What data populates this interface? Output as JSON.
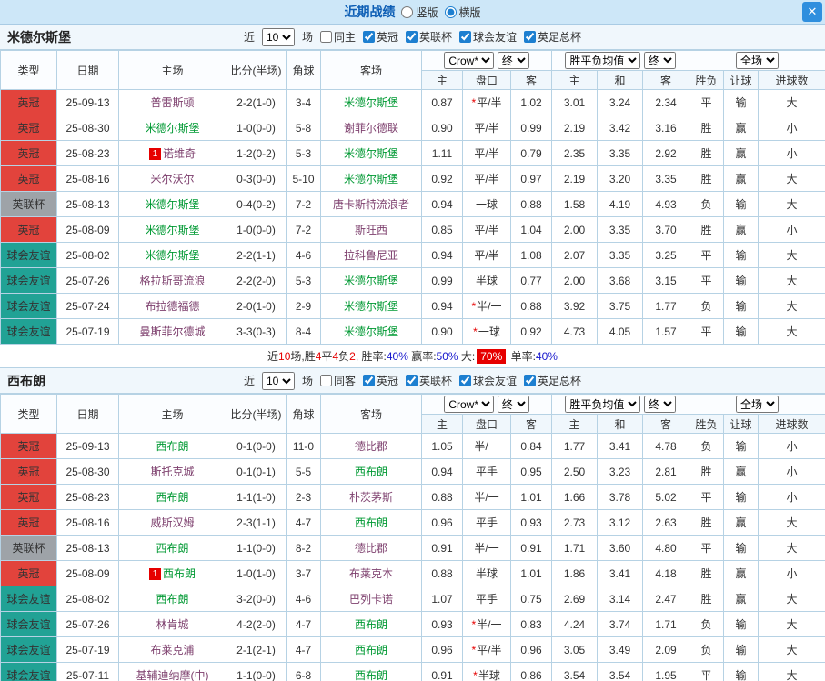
{
  "topbar": {
    "title": "近期战绩",
    "radio_vertical": "竖版",
    "radio_horizontal": "横版"
  },
  "filters": {
    "near_label": "近",
    "count": "10",
    "games_label": "场",
    "leagues": [
      "英冠",
      "英联杯",
      "球会友谊",
      "英足总杯"
    ]
  },
  "header": {
    "col_type": "类型",
    "col_date": "日期",
    "col_home": "主场",
    "col_score": "比分(半场)",
    "col_corner": "角球",
    "col_away": "客场",
    "select_company": "Crow*",
    "select_final": "终",
    "select_avg": "胜平负均值",
    "select_period": "全场",
    "sub_home": "主",
    "sub_handicap": "盘口",
    "sub_away": "客",
    "sub_draw": "和",
    "sub_result": "胜负",
    "sub_let": "让球",
    "sub_goals": "进球数"
  },
  "star_mark": "*",
  "rank_mark": "1",
  "colors": {
    "accent_blue": "#1d7fd0",
    "badge_red": "#e2433c",
    "badge_gray": "#9ea3a8",
    "badge_teal": "#21a295",
    "focus_green": "#009933",
    "score_red": "#e60000"
  },
  "team1": {
    "name": "米德尔斯堡",
    "same_label": "同主",
    "rows": [
      {
        "type": "英冠",
        "date": "25-09-13",
        "home": "普雷斯顿",
        "home_focus": false,
        "home_mark": false,
        "score": "2-2(1-0)",
        "corner": "3-4",
        "away": "米德尔斯堡",
        "away_focus": true,
        "away_mark": false,
        "odds_home": "0.87",
        "handicap_star": true,
        "handicap": "平/半",
        "odds_away": "1.02",
        "avg_home": "3.01",
        "avg_draw": "3.24",
        "avg_away": "2.34",
        "result": "平",
        "let_result": "输",
        "goals": "大"
      },
      {
        "type": "英冠",
        "date": "25-08-30",
        "home": "米德尔斯堡",
        "home_focus": true,
        "home_mark": false,
        "score": "1-0(0-0)",
        "corner": "5-8",
        "away": "谢菲尔德联",
        "away_focus": false,
        "away_mark": false,
        "odds_home": "0.90",
        "handicap_star": false,
        "handicap": "平/半",
        "odds_away": "0.99",
        "avg_home": "2.19",
        "avg_draw": "3.42",
        "avg_away": "3.16",
        "result": "胜",
        "let_result": "赢",
        "goals": "小"
      },
      {
        "type": "英冠",
        "date": "25-08-23",
        "home": "诺维奇",
        "home_focus": false,
        "home_mark": true,
        "score": "1-2(0-2)",
        "corner": "5-3",
        "away": "米德尔斯堡",
        "away_focus": true,
        "away_mark": false,
        "odds_home": "1.11",
        "handicap_star": false,
        "handicap": "平/半",
        "odds_away": "0.79",
        "avg_home": "2.35",
        "avg_draw": "3.35",
        "avg_away": "2.92",
        "result": "胜",
        "let_result": "赢",
        "goals": "小"
      },
      {
        "type": "英冠",
        "date": "25-08-16",
        "home": "米尔沃尔",
        "home_focus": false,
        "home_mark": false,
        "score": "0-3(0-0)",
        "corner": "5-10",
        "away": "米德尔斯堡",
        "away_focus": true,
        "away_mark": false,
        "odds_home": "0.92",
        "handicap_star": false,
        "handicap": "平/半",
        "odds_away": "0.97",
        "avg_home": "2.19",
        "avg_draw": "3.20",
        "avg_away": "3.35",
        "result": "胜",
        "let_result": "赢",
        "goals": "大"
      },
      {
        "type": "英联杯",
        "date": "25-08-13",
        "home": "米德尔斯堡",
        "home_focus": true,
        "home_mark": false,
        "score": "0-4(0-2)",
        "corner": "7-2",
        "away": "唐卡斯特流浪者",
        "away_focus": false,
        "away_mark": false,
        "odds_home": "0.94",
        "handicap_star": false,
        "handicap": "一球",
        "odds_away": "0.88",
        "avg_home": "1.58",
        "avg_draw": "4.19",
        "avg_away": "4.93",
        "result": "负",
        "let_result": "输",
        "goals": "大"
      },
      {
        "type": "英冠",
        "date": "25-08-09",
        "home": "米德尔斯堡",
        "home_focus": true,
        "home_mark": false,
        "score": "1-0(0-0)",
        "corner": "7-2",
        "away": "斯旺西",
        "away_focus": false,
        "away_mark": false,
        "odds_home": "0.85",
        "handicap_star": false,
        "handicap": "平/半",
        "odds_away": "1.04",
        "avg_home": "2.00",
        "avg_draw": "3.35",
        "avg_away": "3.70",
        "result": "胜",
        "let_result": "赢",
        "goals": "小"
      },
      {
        "type": "球会友谊",
        "date": "25-08-02",
        "home": "米德尔斯堡",
        "home_focus": true,
        "home_mark": false,
        "score": "2-2(1-1)",
        "corner": "4-6",
        "away": "拉科鲁尼亚",
        "away_focus": false,
        "away_mark": false,
        "odds_home": "0.94",
        "handicap_star": false,
        "handicap": "平/半",
        "odds_away": "1.08",
        "avg_home": "2.07",
        "avg_draw": "3.35",
        "avg_away": "3.25",
        "result": "平",
        "let_result": "输",
        "goals": "大"
      },
      {
        "type": "球会友谊",
        "date": "25-07-26",
        "home": "格拉斯哥流浪",
        "home_focus": false,
        "home_mark": false,
        "score": "2-2(2-0)",
        "corner": "5-3",
        "away": "米德尔斯堡",
        "away_focus": true,
        "away_mark": false,
        "odds_home": "0.99",
        "handicap_star": false,
        "handicap": "半球",
        "odds_away": "0.77",
        "avg_home": "2.00",
        "avg_draw": "3.68",
        "avg_away": "3.15",
        "result": "平",
        "let_result": "输",
        "goals": "大"
      },
      {
        "type": "球会友谊",
        "date": "25-07-24",
        "home": "布拉德福德",
        "home_focus": false,
        "home_mark": false,
        "score": "2-0(1-0)",
        "corner": "2-9",
        "away": "米德尔斯堡",
        "away_focus": true,
        "away_mark": false,
        "odds_home": "0.94",
        "handicap_star": true,
        "handicap": "半/一",
        "odds_away": "0.88",
        "avg_home": "3.92",
        "avg_draw": "3.75",
        "avg_away": "1.77",
        "result": "负",
        "let_result": "输",
        "goals": "大"
      },
      {
        "type": "球会友谊",
        "date": "25-07-19",
        "home": "曼斯菲尔德城",
        "home_focus": false,
        "home_mark": false,
        "score": "3-3(0-3)",
        "corner": "8-4",
        "away": "米德尔斯堡",
        "away_focus": true,
        "away_mark": false,
        "odds_home": "0.90",
        "handicap_star": true,
        "handicap": "一球",
        "odds_away": "0.92",
        "avg_home": "4.73",
        "avg_draw": "4.05",
        "avg_away": "1.57",
        "result": "平",
        "let_result": "输",
        "goals": "大"
      }
    ],
    "summary": [
      {
        "text": "近",
        "style": "plain"
      },
      {
        "text": "10",
        "style": "red"
      },
      {
        "text": "场,胜",
        "style": "plain"
      },
      {
        "text": "4",
        "style": "red"
      },
      {
        "text": "平",
        "style": "plain"
      },
      {
        "text": "4",
        "style": "red"
      },
      {
        "text": "负",
        "style": "plain"
      },
      {
        "text": "2",
        "style": "red"
      },
      {
        "text": ", 胜率:",
        "style": "plain"
      },
      {
        "text": "40%",
        "style": "blue"
      },
      {
        "text": " 赢率:",
        "style": "plain"
      },
      {
        "text": "50%",
        "style": "blue"
      },
      {
        "text": " 大:",
        "style": "plain"
      },
      {
        "text": "70%",
        "style": "hot"
      },
      {
        "text": " 单率:",
        "style": "plain"
      },
      {
        "text": "40%",
        "style": "blue"
      }
    ]
  },
  "team2": {
    "name": "西布朗",
    "same_label": "同客",
    "rows": [
      {
        "type": "英冠",
        "date": "25-09-13",
        "home": "西布朗",
        "home_focus": true,
        "home_mark": false,
        "score": "0-1(0-0)",
        "corner": "11-0",
        "away": "德比郡",
        "away_focus": false,
        "away_mark": false,
        "odds_home": "1.05",
        "handicap_star": false,
        "handicap": "半/一",
        "odds_away": "0.84",
        "avg_home": "1.77",
        "avg_draw": "3.41",
        "avg_away": "4.78",
        "result": "负",
        "let_result": "输",
        "goals": "小"
      },
      {
        "type": "英冠",
        "date": "25-08-30",
        "home": "斯托克城",
        "home_focus": false,
        "home_mark": false,
        "score": "0-1(0-1)",
        "corner": "5-5",
        "away": "西布朗",
        "away_focus": true,
        "away_mark": false,
        "odds_home": "0.94",
        "handicap_star": false,
        "handicap": "平手",
        "odds_away": "0.95",
        "avg_home": "2.50",
        "avg_draw": "3.23",
        "avg_away": "2.81",
        "result": "胜",
        "let_result": "赢",
        "goals": "小"
      },
      {
        "type": "英冠",
        "date": "25-08-23",
        "home": "西布朗",
        "home_focus": true,
        "home_mark": false,
        "score": "1-1(1-0)",
        "corner": "2-3",
        "away": "朴茨茅斯",
        "away_focus": false,
        "away_mark": false,
        "odds_home": "0.88",
        "handicap_star": false,
        "handicap": "半/一",
        "odds_away": "1.01",
        "avg_home": "1.66",
        "avg_draw": "3.78",
        "avg_away": "5.02",
        "result": "平",
        "let_result": "输",
        "goals": "小"
      },
      {
        "type": "英冠",
        "date": "25-08-16",
        "home": "威斯汉姆",
        "home_focus": false,
        "home_mark": false,
        "score": "2-3(1-1)",
        "corner": "4-7",
        "away": "西布朗",
        "away_focus": true,
        "away_mark": false,
        "odds_home": "0.96",
        "handicap_star": false,
        "handicap": "平手",
        "odds_away": "0.93",
        "avg_home": "2.73",
        "avg_draw": "3.12",
        "avg_away": "2.63",
        "result": "胜",
        "let_result": "赢",
        "goals": "大"
      },
      {
        "type": "英联杯",
        "date": "25-08-13",
        "home": "西布朗",
        "home_focus": true,
        "home_mark": false,
        "score": "1-1(0-0)",
        "corner": "8-2",
        "away": "德比郡",
        "away_focus": false,
        "away_mark": false,
        "odds_home": "0.91",
        "handicap_star": false,
        "handicap": "半/一",
        "odds_away": "0.91",
        "avg_home": "1.71",
        "avg_draw": "3.60",
        "avg_away": "4.80",
        "result": "平",
        "let_result": "输",
        "goals": "大"
      },
      {
        "type": "英冠",
        "date": "25-08-09",
        "home": "西布朗",
        "home_focus": true,
        "home_mark": true,
        "score": "1-0(1-0)",
        "corner": "3-7",
        "away": "布莱克本",
        "away_focus": false,
        "away_mark": false,
        "odds_home": "0.88",
        "handicap_star": false,
        "handicap": "半球",
        "odds_away": "1.01",
        "avg_home": "1.86",
        "avg_draw": "3.41",
        "avg_away": "4.18",
        "result": "胜",
        "let_result": "赢",
        "goals": "小"
      },
      {
        "type": "球会友谊",
        "date": "25-08-02",
        "home": "西布朗",
        "home_focus": true,
        "home_mark": false,
        "score": "3-2(0-0)",
        "corner": "4-6",
        "away": "巴列卡诺",
        "away_focus": false,
        "away_mark": false,
        "odds_home": "1.07",
        "handicap_star": false,
        "handicap": "平手",
        "odds_away": "0.75",
        "avg_home": "2.69",
        "avg_draw": "3.14",
        "avg_away": "2.47",
        "result": "胜",
        "let_result": "赢",
        "goals": "大"
      },
      {
        "type": "球会友谊",
        "date": "25-07-26",
        "home": "林肯城",
        "home_focus": false,
        "home_mark": false,
        "score": "4-2(2-0)",
        "corner": "4-7",
        "away": "西布朗",
        "away_focus": true,
        "away_mark": false,
        "odds_home": "0.93",
        "handicap_star": true,
        "handicap": "半/一",
        "odds_away": "0.83",
        "avg_home": "4.24",
        "avg_draw": "3.74",
        "avg_away": "1.71",
        "result": "负",
        "let_result": "输",
        "goals": "大"
      },
      {
        "type": "球会友谊",
        "date": "25-07-19",
        "home": "布莱克浦",
        "home_focus": false,
        "home_mark": false,
        "score": "2-1(2-1)",
        "corner": "4-7",
        "away": "西布朗",
        "away_focus": true,
        "away_mark": false,
        "odds_home": "0.96",
        "handicap_star": true,
        "handicap": "平/半",
        "odds_away": "0.96",
        "avg_home": "3.05",
        "avg_draw": "3.49",
        "avg_away": "2.09",
        "result": "负",
        "let_result": "输",
        "goals": "大"
      },
      {
        "type": "球会友谊",
        "date": "25-07-11",
        "home": "基辅迪纳摩(中)",
        "home_focus": false,
        "home_mark": false,
        "score": "1-1(0-0)",
        "corner": "6-8",
        "away": "西布朗",
        "away_focus": true,
        "away_mark": false,
        "odds_home": "0.91",
        "handicap_star": true,
        "handicap": "半球",
        "odds_away": "0.86",
        "avg_home": "3.54",
        "avg_draw": "3.54",
        "avg_away": "1.95",
        "result": "平",
        "let_result": "输",
        "goals": "大"
      }
    ]
  }
}
